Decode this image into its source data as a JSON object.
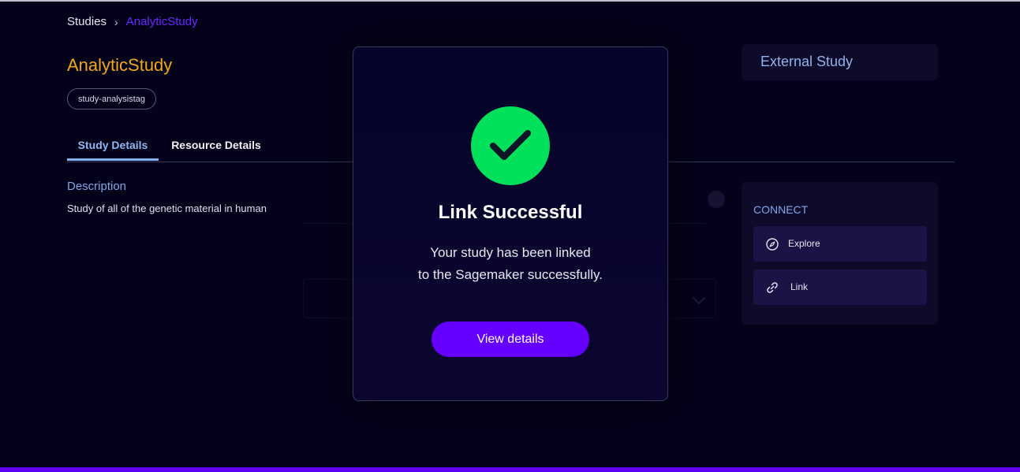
{
  "breadcrumb": {
    "root": "Studies",
    "separator": "›",
    "current": "AnalyticStudy"
  },
  "study": {
    "title": "AnalyticStudy",
    "tag": "study-analysistag"
  },
  "tabs": [
    {
      "label": "Study Details",
      "active": true
    },
    {
      "label": "Resource Details",
      "active": false
    }
  ],
  "description": {
    "label": "Description",
    "text": "Study of all of the genetic material in human"
  },
  "external": {
    "title": "External Study"
  },
  "connect": {
    "title": "CONNECT",
    "buttons": [
      {
        "label": "Explore",
        "icon": "compass-icon"
      },
      {
        "label": "Link",
        "icon": "link-icon"
      }
    ]
  },
  "modal": {
    "title": "Link Successful",
    "message_line1": "Your study has been linked",
    "message_line2": "to the Sagemaker successfully.",
    "button_label": "View details",
    "icon": "check-circle-icon"
  },
  "colors": {
    "background": "#04021a",
    "accent_purple": "#6500ff",
    "success_green": "#00e05b",
    "title_orange": "#f0a81a",
    "link_blue": "#7fa8e6"
  }
}
